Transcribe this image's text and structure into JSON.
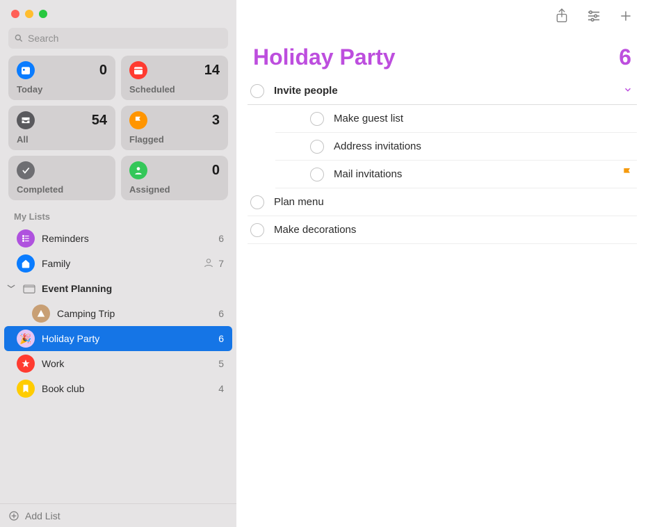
{
  "search": {
    "placeholder": "Search"
  },
  "smart_tiles": [
    {
      "label": "Today",
      "count": 0,
      "color": "#0a7cff"
    },
    {
      "label": "Scheduled",
      "count": 14,
      "color": "#ff3b30"
    },
    {
      "label": "All",
      "count": 54,
      "color": "#59595d"
    },
    {
      "label": "Flagged",
      "count": 3,
      "color": "#ff9500"
    },
    {
      "label": "Completed",
      "count": "",
      "color": "#6e6e72"
    },
    {
      "label": "Assigned",
      "count": 0,
      "color": "#34c759"
    }
  ],
  "sidebar": {
    "section_label": "My Lists",
    "add_list_label": "Add List",
    "lists": {
      "reminders": {
        "name": "Reminders",
        "count": 6
      },
      "family": {
        "name": "Family",
        "count": 7,
        "shared": true
      },
      "group": {
        "name": "Event Planning"
      },
      "camping": {
        "name": "Camping Trip",
        "count": 6
      },
      "holiday": {
        "name": "Holiday Party",
        "count": 6
      },
      "work": {
        "name": "Work",
        "count": 5
      },
      "bookclub": {
        "name": "Book club",
        "count": 4
      }
    }
  },
  "main": {
    "title": "Holiday Party",
    "count": 6,
    "reminders": [
      {
        "title": "Invite people"
      },
      {
        "title": "Make guest list"
      },
      {
        "title": "Address invitations"
      },
      {
        "title": "Mail invitations"
      },
      {
        "title": "Plan menu"
      },
      {
        "title": "Make decorations"
      }
    ]
  }
}
